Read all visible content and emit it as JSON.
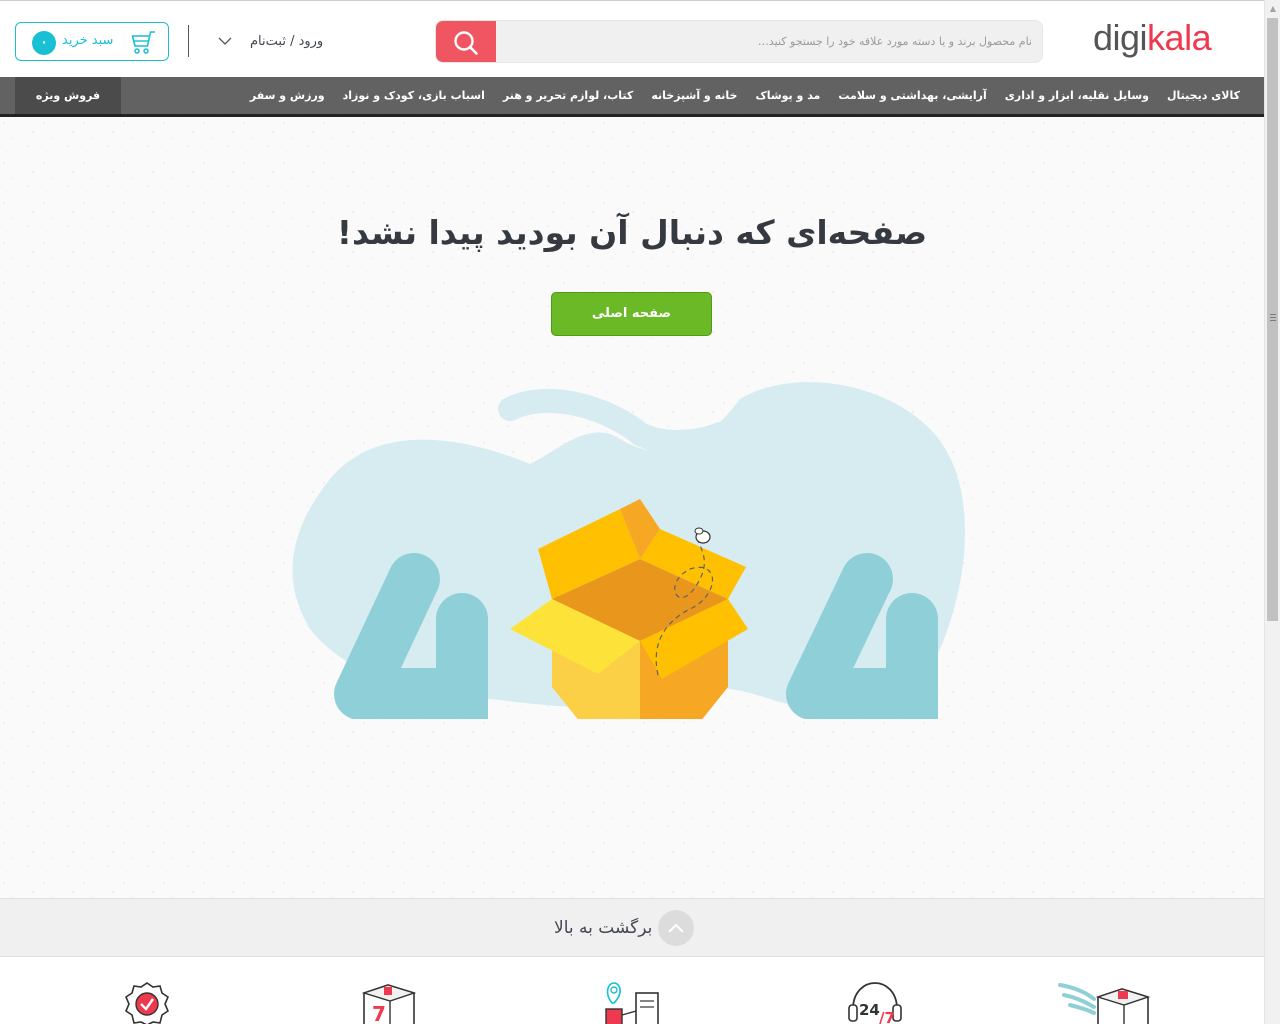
{
  "header": {
    "logo": {
      "part1": "digi",
      "part2": "kala"
    },
    "search": {
      "placeholder": "نام محصول برند و یا دسته مورد علاقه خود را جستجو کنید…",
      "value": ""
    },
    "auth_label": "ورود / ثبت‌نام",
    "cart": {
      "label": "سبد خرید",
      "count": "۰"
    }
  },
  "nav": {
    "items": [
      "کالای دیجیتال",
      "وسایل نقلیه، ابزار و اداری",
      "آرایشی، بهداشتی و سلامت",
      "مد و پوشاک",
      "خانه و آشپزخانه",
      "کتاب، لوازم تحریر و هنر",
      "اسباب بازی، کودک و نوزاد",
      "ورزش و سفر"
    ],
    "special": "فروش ویژه"
  },
  "main": {
    "title": "صفحه‌ای که دنبال آن بودید پیدا نشد!",
    "home_button": "صفحه اصلی",
    "illustration": {
      "digit_left": "4",
      "digit_right": "4",
      "icon": "open-box-illustration"
    }
  },
  "back_to_top": {
    "label": "برگشت به بالا"
  },
  "footer": {
    "features": [
      {
        "icon": "express-delivery-icon"
      },
      {
        "icon": "support-24-7-icon"
      },
      {
        "icon": "pay-on-delivery-icon"
      },
      {
        "icon": "seven-day-return-icon"
      },
      {
        "icon": "original-guarantee-icon"
      }
    ]
  },
  "colors": {
    "brand_red": "#ef394e",
    "search_button": "#ef5662",
    "cart_accent": "#19bfd3",
    "nav_bg": "#626262",
    "home_button_green": "#6bb927",
    "illustration_blob": "#d7ecf0",
    "illustration_digits": "#8fd0d8",
    "box_yellow": "#fec001"
  }
}
